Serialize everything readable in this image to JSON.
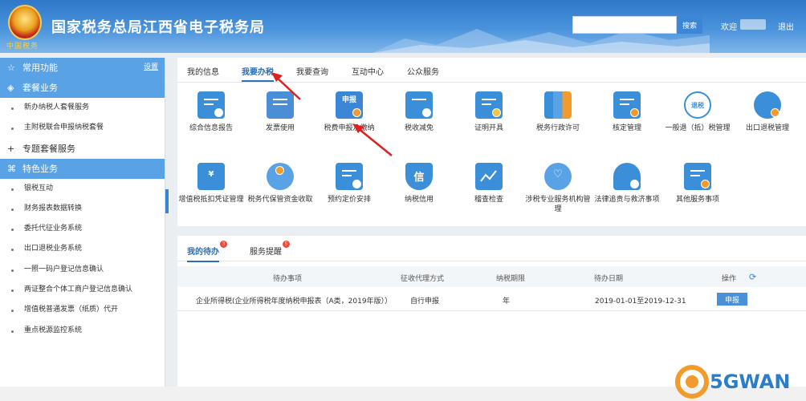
{
  "header": {
    "site_title": "国家税务总局江西省电子税务局",
    "emblem_text": "中国税务",
    "search_placeholder": "",
    "search_button": "搜索",
    "welcome": "欢迎",
    "logout": "退出",
    "colors": {
      "primary": "#2f78c9",
      "accent": "#5aa2e6"
    }
  },
  "sidebar": {
    "sections": [
      {
        "title": "常用功能",
        "icon": "star-icon",
        "action": "设置",
        "style": "blue",
        "items": []
      },
      {
        "title": "套餐业务",
        "icon": "layers-icon",
        "style": "blue",
        "items": [
          "新办纳税人套餐服务",
          "主附税联合申报纳税套餐"
        ]
      },
      {
        "title": "专题套餐服务",
        "icon": "plus-icon",
        "style": "plain",
        "items": []
      },
      {
        "title": "特色业务",
        "icon": "grid-icon",
        "style": "blue",
        "items": [
          "银税互动",
          "财务报表数据转换",
          "委托代征业务系统",
          "出口退税业务系统",
          "一照一码户登记信息确认",
          "两证整合个体工商户登记信息确认",
          "增值税普通发票（纸质）代开",
          "重点税源监控系统"
        ]
      }
    ]
  },
  "main": {
    "tabs": [
      "我的信息",
      "我要办税",
      "我要查询",
      "互动中心",
      "公众服务"
    ],
    "active_tab": "我要办税",
    "tiles": [
      {
        "label": "综合信息报告",
        "icon": "report-icon",
        "color": "#3b8fd9"
      },
      {
        "label": "发票使用",
        "icon": "printer-icon",
        "color": "#4a8fd6"
      },
      {
        "label": "税费申报及缴纳",
        "icon": "declare-icon",
        "color": "#3b87d6",
        "glyph": "申报"
      },
      {
        "label": "税收减免",
        "icon": "calculator-icon",
        "color": "#3b8fd9"
      },
      {
        "label": "证明开具",
        "icon": "certificate-icon",
        "color": "#3b8fd9"
      },
      {
        "label": "税务行政许可",
        "icon": "binders-icon",
        "color": "#3b8fd9"
      },
      {
        "label": "核定管理",
        "icon": "clipboard-icon",
        "color": "#3b8fd9"
      },
      {
        "label": "一般退（抵）税管理",
        "icon": "refund-icon",
        "color": "#3b8fd9",
        "glyph": "退税"
      },
      {
        "label": "出口退税管理",
        "icon": "ship-icon",
        "color": "#3b8fd9"
      },
      {
        "label": "增值税抵扣凭证管理",
        "icon": "voucher-icon",
        "color": "#3b8fd9",
        "glyph": "¥"
      },
      {
        "label": "税务代保管资金收取",
        "icon": "hand-money-icon",
        "color": "#3b8fd9"
      },
      {
        "label": "预约定价安排",
        "icon": "calendar-icon",
        "color": "#3b8fd9"
      },
      {
        "label": "纳税信用",
        "icon": "shield-icon",
        "color": "#3b8fd9",
        "glyph": "信"
      },
      {
        "label": "稽查检查",
        "icon": "monitor-chart-icon",
        "color": "#3b8fd9"
      },
      {
        "label": "涉税专业服务机构管理",
        "icon": "heart-hand-icon",
        "color": "#3b8fd9"
      },
      {
        "label": "法律追责与救济事项",
        "icon": "user-law-icon",
        "color": "#3b8fd9"
      },
      {
        "label": "其他服务事项",
        "icon": "other-service-icon",
        "color": "#3b8fd9"
      }
    ]
  },
  "todo": {
    "tabs": [
      {
        "label": "我的待办",
        "badge": "3"
      },
      {
        "label": "服务提醒",
        "badge": "5"
      }
    ],
    "columns": [
      "待办事项",
      "征收代理方式",
      "纳税期限",
      "待办日期",
      "操作"
    ],
    "rows": [
      {
        "item": "企业所得税(企业所得税年度纳税申报表（A类，2019年版））",
        "mode": "自行申报",
        "period": "年",
        "date": "2019-01-01至2019-12-31",
        "action": "申报"
      }
    ]
  },
  "watermark": {
    "text": "5GWAN"
  }
}
